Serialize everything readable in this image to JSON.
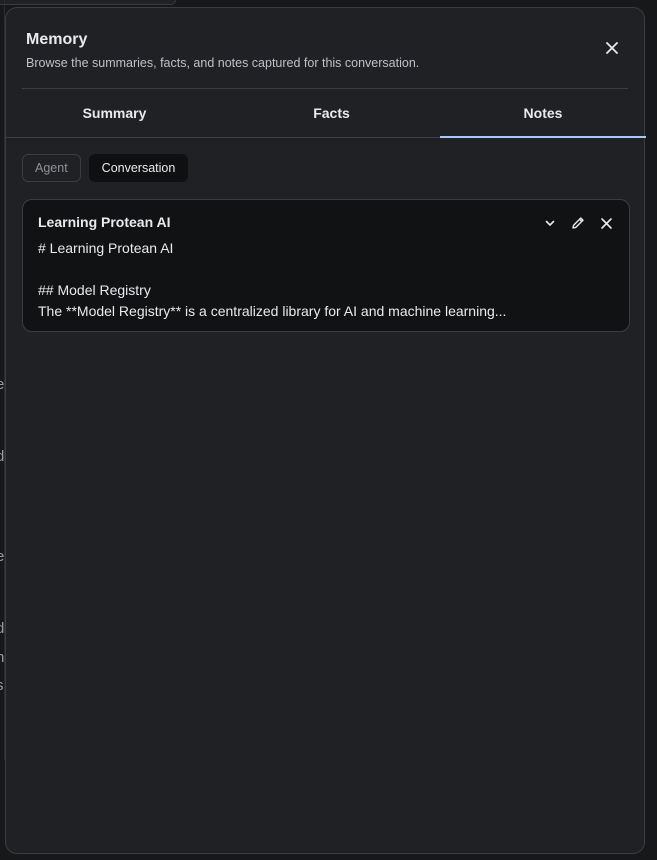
{
  "dialog": {
    "title": "Memory",
    "subtitle": "Browse the summaries, facts, and notes captured for this conversation.",
    "close_icon": "close-icon"
  },
  "tabs": [
    {
      "label": "Summary",
      "active": false
    },
    {
      "label": "Facts",
      "active": false
    },
    {
      "label": "Notes",
      "active": true
    }
  ],
  "scope_chips": [
    {
      "label": "Agent",
      "selected": false
    },
    {
      "label": "Conversation",
      "selected": true
    }
  ],
  "notes": [
    {
      "title": "Learning Protean AI",
      "lines": [
        "# Learning Protean AI",
        "",
        "## Model Registry",
        "The **Model Registry** is a centralized library for AI and machine learning..."
      ],
      "actions": [
        "chevron-down-icon",
        "pencil-icon",
        "close-icon"
      ]
    }
  ],
  "background_peek": [
    "e",
    "d",
    "e",
    "d",
    "n",
    "s"
  ],
  "colors": {
    "dialog_bg": "#202124",
    "card_bg": "#111214",
    "accent_tab_underline": "#a8c7fa",
    "text_primary": "#e8eaed",
    "text_secondary": "#bdc1c6",
    "border": "#3c3d40"
  }
}
